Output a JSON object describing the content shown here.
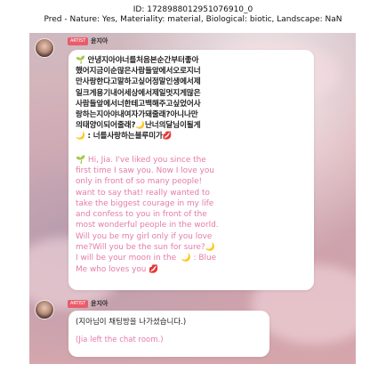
{
  "header": {
    "id_line": "ID: 1728988012951076910_0",
    "pred_line": "Pred - Nature: Yes, Materiality: material, Biological: biotic, Landscape: NaN"
  },
  "chat": {
    "sender_tag": "ARTIST",
    "sender_name": "윤지아",
    "message1": {
      "korean_lines": [
        "안녕지아야너를처음본순간부터좋아",
        "했어지금이순많은사람들앞에서오로지너",
        "만사랑한다고말하고싶어정말인생에서제",
        "일크게용기내어세상에서제일멋지게많은",
        "사람들앞에서너한테고백해주고싶었어사",
        "랑하는지아야내여자가돼줄래?아니나만",
        "의태양이되어줄래?",
        "난너의달님이될게",
        ": 너를사랑하는블루미가"
      ],
      "english_lines": [
        "Hi, Jia. I've liked you since the",
        "first time I saw you. Now I love you",
        "only in front of so many people!",
        "want to say that! really wanted to",
        "take the biggest courage in my life",
        "and confess to you in front of the",
        "most wonderful people in the world.",
        "Will you be my girl only if you love",
        "me?Will you be the sun for sure?",
        "I will be your moon in the",
        ": Blue",
        "Me who loves you"
      ]
    },
    "message2": {
      "korean": "(지아님이 채팅방을 나가셨습니다.)",
      "english": "(Jia left the chat room.)"
    },
    "icons": {
      "sprout": "sprout-icon",
      "moon": "moon-emoji-icon",
      "kiss": "kiss-lips-icon"
    }
  }
}
